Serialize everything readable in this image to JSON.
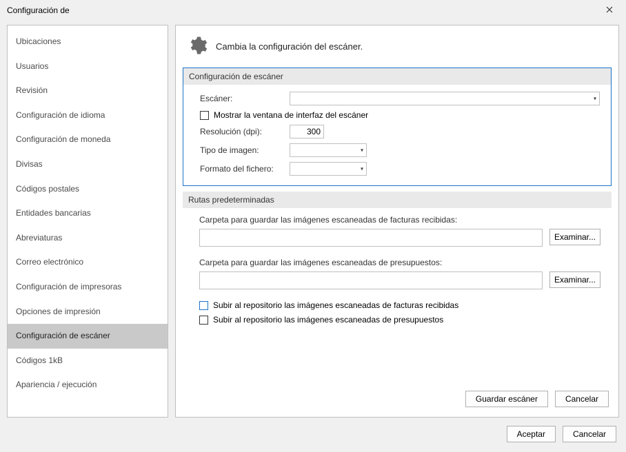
{
  "window": {
    "title": "Configuración de"
  },
  "sidebar": {
    "items": [
      {
        "label": "Ubicaciones"
      },
      {
        "label": "Usuarios"
      },
      {
        "label": "Revisión"
      },
      {
        "label": "Configuración de idioma"
      },
      {
        "label": "Configuración de moneda"
      },
      {
        "label": "Divisas"
      },
      {
        "label": "Códigos postales"
      },
      {
        "label": "Entidades bancarias"
      },
      {
        "label": "Abreviaturas"
      },
      {
        "label": "Correo electrónico"
      },
      {
        "label": "Configuración de impresoras"
      },
      {
        "label": "Opciones de impresión"
      },
      {
        "label": "Configuración de escáner"
      },
      {
        "label": "Códigos 1kB"
      },
      {
        "label": "Apariencia / ejecución"
      }
    ],
    "selected_index": 12
  },
  "main": {
    "header": "Cambia la configuración del escáner.",
    "scanner_group": {
      "title": "Configuración de escáner",
      "scanner_label": "Escáner:",
      "scanner_value": "",
      "show_interface_checkbox": "Mostrar la ventana de interfaz del escáner",
      "resolution_label": "Resolución (dpi):",
      "resolution_value": "300",
      "image_type_label": "Tipo de imagen:",
      "image_type_value": "",
      "file_format_label": "Formato del fichero:",
      "file_format_value": ""
    },
    "paths_group": {
      "title": "Rutas predeterminadas",
      "invoices_label": "Carpeta para guardar las imágenes escaneadas de facturas recibidas:",
      "invoices_value": "",
      "budgets_label": "Carpeta para guardar las imágenes escaneadas de presupuestos:",
      "budgets_value": "",
      "browse_label": "Examinar...",
      "upload_invoices_checkbox": "Subir al repositorio las imágenes escaneadas de facturas recibidas",
      "upload_budgets_checkbox": "Subir al repositorio las imágenes escaneadas de presupuestos"
    },
    "footer": {
      "save_label": "Guardar escáner",
      "cancel_label": "Cancelar"
    }
  },
  "dialog_footer": {
    "accept_label": "Aceptar",
    "cancel_label": "Cancelar"
  }
}
